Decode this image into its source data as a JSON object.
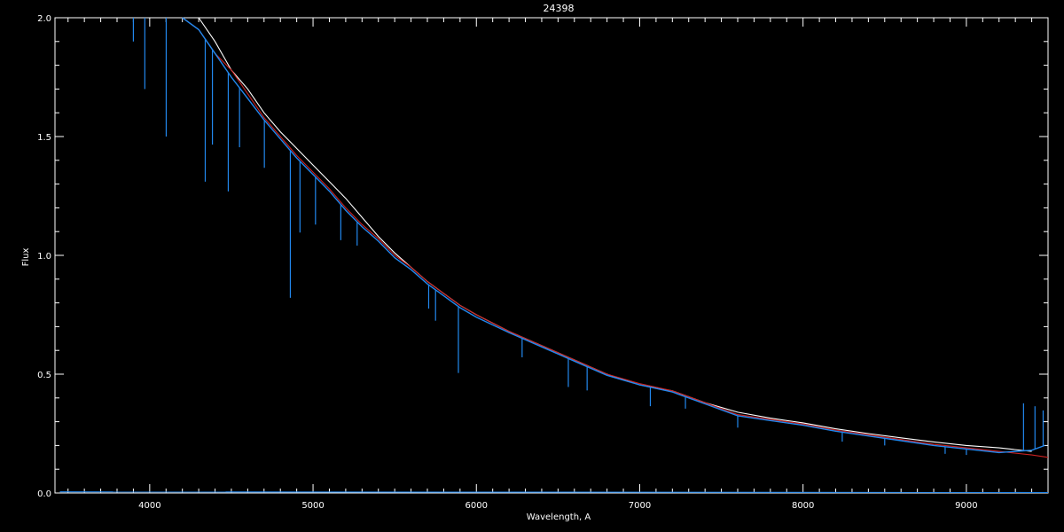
{
  "chart_data": {
    "type": "line",
    "title": "24398",
    "xlabel": "Wavelength, A",
    "ylabel": "Flux",
    "xlim": [
      3420,
      9500
    ],
    "ylim": [
      0.0,
      2.0
    ],
    "xticks": [
      4000,
      5000,
      6000,
      7000,
      8000,
      9000
    ],
    "xtick_labels": [
      "4000",
      "5000",
      "6000",
      "7000",
      "8000",
      "9000"
    ],
    "yticks": [
      0.0,
      0.5,
      1.0,
      1.5,
      2.0
    ],
    "ytick_labels": [
      "0.0",
      "0.5",
      "1.0",
      "1.5",
      "2.0"
    ],
    "grid": false,
    "background": "#000000",
    "axis_color": "#ffffff",
    "series": [
      {
        "color": "#ffffff",
        "x": [
          4200,
          4300,
          4400,
          4500,
          4600,
          4700,
          4800,
          4900,
          5000,
          5100,
          5200,
          5300,
          5400,
          5500,
          5600,
          5700,
          5800,
          5900,
          6000,
          6200,
          6400,
          6600,
          6800,
          7000,
          7200,
          7400,
          7600,
          7800,
          8000,
          8200,
          8400,
          8600,
          8800,
          9000,
          9200,
          9400
        ],
        "y": [
          2.05,
          2.0,
          1.9,
          1.78,
          1.7,
          1.6,
          1.52,
          1.45,
          1.38,
          1.31,
          1.24,
          1.16,
          1.08,
          1.01,
          0.95,
          0.89,
          0.84,
          0.79,
          0.75,
          0.68,
          0.62,
          0.56,
          0.5,
          0.455,
          0.43,
          0.38,
          0.34,
          0.315,
          0.295,
          0.27,
          0.25,
          0.232,
          0.215,
          0.2,
          0.19,
          0.175
        ]
      },
      {
        "color": "#cc2222",
        "x": [
          4200,
          4300,
          4400,
          4500,
          4600,
          4700,
          4800,
          4900,
          5000,
          5100,
          5200,
          5300,
          5400,
          5500,
          5600,
          5700,
          5800,
          5900,
          6000,
          6200,
          6400,
          6600,
          6800,
          7000,
          7200,
          7400,
          7600,
          7800,
          8000,
          8200,
          8400,
          8600,
          8800,
          9000,
          9200,
          9400,
          9500
        ],
        "y": [
          2.05,
          1.95,
          1.85,
          1.78,
          1.68,
          1.58,
          1.5,
          1.42,
          1.35,
          1.28,
          1.2,
          1.13,
          1.07,
          1.0,
          0.95,
          0.89,
          0.84,
          0.79,
          0.75,
          0.68,
          0.62,
          0.56,
          0.5,
          0.46,
          0.43,
          0.38,
          0.33,
          0.31,
          0.29,
          0.265,
          0.245,
          0.225,
          0.205,
          0.19,
          0.175,
          0.16,
          0.15
        ]
      },
      {
        "color": "#2288ee",
        "x": [
          4200,
          4300,
          4400,
          4500,
          4600,
          4700,
          4800,
          4900,
          5000,
          5100,
          5200,
          5300,
          5400,
          5500,
          5600,
          5700,
          5800,
          5900,
          6000,
          6200,
          6400,
          6600,
          6800,
          7000,
          7200,
          7400,
          7600,
          7800,
          8000,
          8200,
          8400,
          8600,
          8800,
          9000,
          9200,
          9400,
          9480
        ],
        "y": [
          2.05,
          1.95,
          1.85,
          1.75,
          1.66,
          1.57,
          1.49,
          1.41,
          1.34,
          1.27,
          1.19,
          1.12,
          1.06,
          0.99,
          0.94,
          0.88,
          0.83,
          0.78,
          0.74,
          0.675,
          0.615,
          0.555,
          0.495,
          0.455,
          0.425,
          0.375,
          0.325,
          0.305,
          0.285,
          0.26,
          0.24,
          0.22,
          0.2,
          0.185,
          0.17,
          0.18,
          0.2
        ]
      },
      {
        "color": "#2288ee",
        "x": [
          3450,
          9500
        ],
        "y": [
          0.005,
          0.002
        ]
      }
    ],
    "absorption_lines": [
      {
        "x": 3900,
        "depth": 0.1
      },
      {
        "x": 3970,
        "depth": 0.3
      },
      {
        "x": 4101,
        "depth": 0.5
      },
      {
        "x": 4340,
        "depth": 0.6
      },
      {
        "x": 4384,
        "depth": 0.4
      },
      {
        "x": 4481,
        "depth": 0.5
      },
      {
        "x": 4550,
        "depth": 0.25
      },
      {
        "x": 4702,
        "depth": 0.2
      },
      {
        "x": 4861,
        "depth": 0.62
      },
      {
        "x": 4920,
        "depth": 0.3
      },
      {
        "x": 5015,
        "depth": 0.2
      },
      {
        "x": 5170,
        "depth": 0.15
      },
      {
        "x": 5270,
        "depth": 0.1
      },
      {
        "x": 5708,
        "depth": 0.1
      },
      {
        "x": 5750,
        "depth": 0.13
      },
      {
        "x": 5890,
        "depth": 0.28
      },
      {
        "x": 6280,
        "depth": 0.08
      },
      {
        "x": 6563,
        "depth": 0.12
      },
      {
        "x": 6678,
        "depth": 0.1
      },
      {
        "x": 7065,
        "depth": 0.08
      },
      {
        "x": 7280,
        "depth": 0.05
      },
      {
        "x": 7600,
        "depth": 0.05
      },
      {
        "x": 8240,
        "depth": 0.04
      },
      {
        "x": 8500,
        "depth": 0.03
      },
      {
        "x": 8870,
        "depth": 0.03
      },
      {
        "x": 9000,
        "depth": 0.025
      }
    ],
    "emission_spikes": [
      {
        "x": 9350,
        "height": 0.2
      },
      {
        "x": 9420,
        "height": 0.18
      },
      {
        "x": 9470,
        "height": 0.15
      }
    ]
  }
}
